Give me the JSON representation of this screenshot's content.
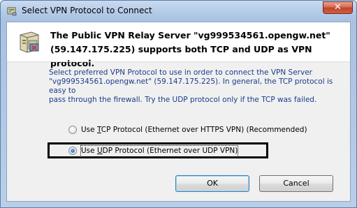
{
  "window": {
    "title": "Select VPN Protocol to Connect",
    "close_glyph": "✕"
  },
  "header": {
    "line1": "The Public VPN Relay Server \"vg999534561.opengw.net\"",
    "line2": "(59.147.175.225) supports both TCP and UDP as VPN protocol."
  },
  "description": {
    "line1": "Select preferred VPN Protocol to use in order to connect the VPN Server",
    "line2": "\"vg999534561.opengw.net\" (59.147.175.225). In general, the TCP protocol is easy to",
    "line3": "pass through the firewall. Try the UDP protocol only if the TCP was failed."
  },
  "options": {
    "tcp": {
      "prefix": "Use ",
      "accel": "T",
      "rest": "CP Protocol (Ethernet over HTTPS VPN) (Recommended)",
      "selected": false
    },
    "udp": {
      "prefix": "Use ",
      "accel": "U",
      "rest": "DP Protocol (Ethernet over UDP VPN)",
      "selected": true
    }
  },
  "buttons": {
    "ok": "OK",
    "cancel": "Cancel"
  },
  "icons": {
    "title": "network-adapter-icon",
    "header": "server-icon",
    "close": "close-icon"
  },
  "colors": {
    "title_gradient_top": "#c9daf0",
    "client_bg": "#f0f0f0",
    "description_text": "#1a3d8a",
    "close_button": "#c0422a"
  }
}
